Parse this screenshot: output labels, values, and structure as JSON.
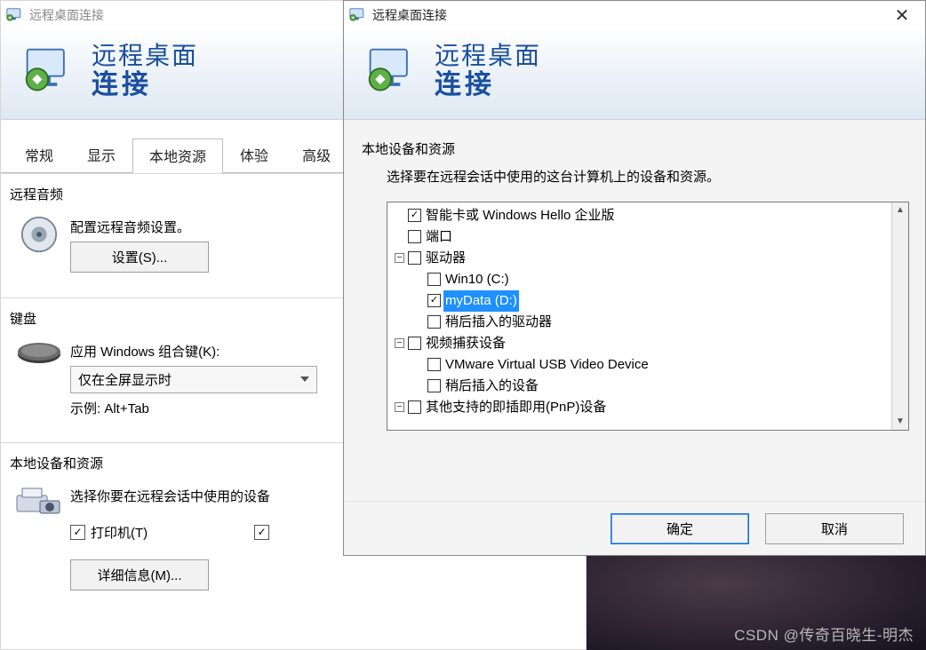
{
  "colors": {
    "accent": "#1a4fa0",
    "selection": "#1e90ff"
  },
  "icons": {
    "rdc": "rdc-monitor-icon",
    "titlebar": "rdc-small-icon",
    "speaker": "speaker-icon",
    "keyboard": "keyboard-icon",
    "devices": "printer-camera-icon"
  },
  "left": {
    "title": "远程桌面连接",
    "banner": {
      "line1": "远程桌面",
      "line2": "连接"
    },
    "tabs": [
      {
        "id": "general",
        "label": "常规"
      },
      {
        "id": "display",
        "label": "显示"
      },
      {
        "id": "local",
        "label": "本地资源",
        "active": true
      },
      {
        "id": "exp",
        "label": "体验"
      },
      {
        "id": "advanced",
        "label": "高级"
      }
    ],
    "audio": {
      "title": "远程音频",
      "desc": "配置远程音频设置。",
      "settings_btn": "设置(S)..."
    },
    "keyboard": {
      "title": "键盘",
      "apply_label": "应用 Windows 组合键(K):",
      "combo_value": "仅在全屏显示时",
      "example_label": "示例: Alt+Tab"
    },
    "localdev": {
      "title": "本地设备和资源",
      "desc": "选择你要在远程会话中使用的设备",
      "printer": {
        "label": "打印机(T)",
        "checked": true
      },
      "clipboard_checked": true,
      "more_btn": "详细信息(M)..."
    }
  },
  "right": {
    "title": "远程桌面连接",
    "banner": {
      "line1": "远程桌面",
      "line2": "连接"
    },
    "section_title": "本地设备和资源",
    "section_desc": "选择要在远程会话中使用的这台计算机上的设备和资源。",
    "tree": [
      {
        "depth": 0,
        "toggle": null,
        "checked": true,
        "label": "智能卡或 Windows Hello 企业版"
      },
      {
        "depth": 0,
        "toggle": null,
        "checked": false,
        "label": "端口"
      },
      {
        "depth": 0,
        "toggle": "minus",
        "checked": false,
        "label": "驱动器"
      },
      {
        "depth": 1,
        "toggle": null,
        "checked": false,
        "label": "Win10 (C:)"
      },
      {
        "depth": 1,
        "toggle": null,
        "checked": true,
        "label": "myData (D:)",
        "selected": true
      },
      {
        "depth": 1,
        "toggle": null,
        "checked": false,
        "label": "稍后插入的驱动器"
      },
      {
        "depth": 0,
        "toggle": "minus",
        "checked": false,
        "label": "视频捕获设备"
      },
      {
        "depth": 1,
        "toggle": null,
        "checked": false,
        "label": "VMware Virtual USB Video Device"
      },
      {
        "depth": 1,
        "toggle": null,
        "checked": false,
        "label": "稍后插入的设备"
      },
      {
        "depth": 0,
        "toggle": "minus",
        "checked": false,
        "label": "其他支持的即插即用(PnP)设备"
      }
    ],
    "ok_label": "确定",
    "cancel_label": "取消"
  },
  "watermark": "CSDN @传奇百晓生-明杰"
}
